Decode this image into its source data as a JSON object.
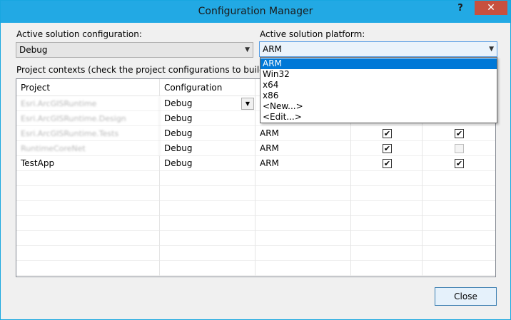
{
  "window": {
    "title": "Configuration Manager",
    "help": "?",
    "close": "✕"
  },
  "config_label": "Active solution configuration:",
  "config_value": "Debug",
  "platform_label": "Active solution platform:",
  "platform_value": "ARM",
  "contexts_label": "Project contexts (check the project configurations to build or dep",
  "columns": [
    "Project",
    "Configuration"
  ],
  "rows": [
    {
      "project": "Esri.ArcGISRuntime",
      "blurred": true,
      "configuration": "Debug",
      "platform": "",
      "build": null,
      "deploy": null
    },
    {
      "project": "Esri.ArcGISRuntime.Design",
      "blurred": true,
      "configuration": "Debug",
      "platform": "",
      "build": null,
      "deploy": null
    },
    {
      "project": "Esri.ArcGISRuntime.Tests",
      "blurred": true,
      "configuration": "Debug",
      "platform": "ARM",
      "build": true,
      "deploy": true
    },
    {
      "project": "RuntimeCoreNet",
      "blurred": true,
      "configuration": "Debug",
      "platform": "ARM",
      "build": true,
      "deploy": false
    },
    {
      "project": "TestApp",
      "blurred": false,
      "configuration": "Debug",
      "platform": "ARM",
      "build": true,
      "deploy": true
    }
  ],
  "platform_options": [
    "ARM",
    "Win32",
    "x64",
    "x86",
    "<New...>",
    "<Edit...>"
  ],
  "selected_option": "ARM",
  "close_button": "Close"
}
